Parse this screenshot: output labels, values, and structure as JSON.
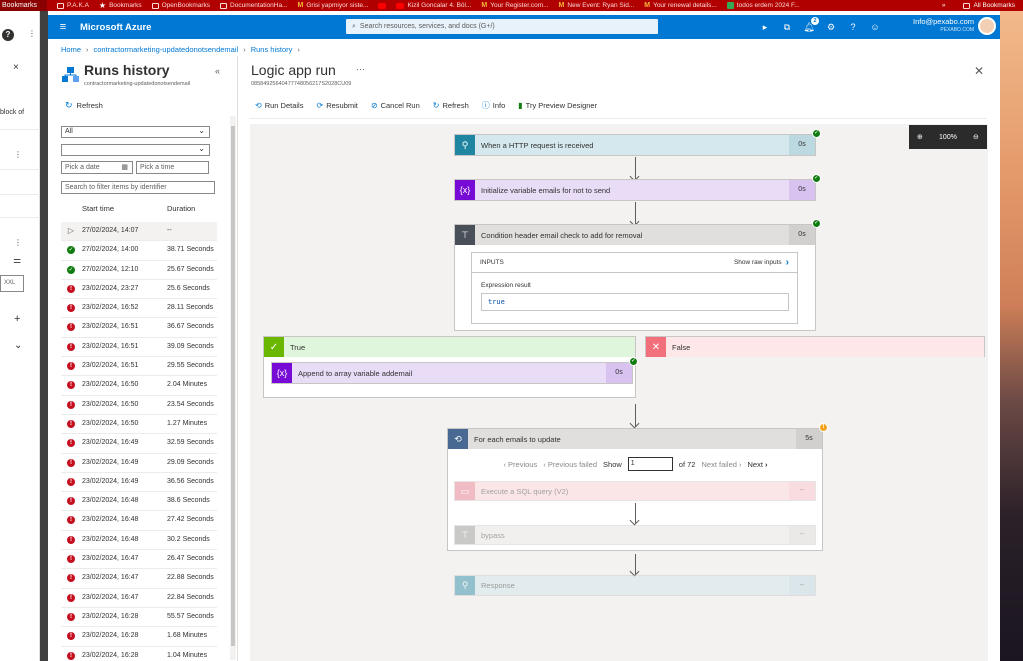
{
  "bookmarks": {
    "left_label": "Bookmarks",
    "items": [
      "P.A.K.A",
      "Bookmarks",
      "OpenBookmarks",
      "DocumentationHa...",
      "Grisi yapmiyor siste...",
      "",
      "Kizil Goncalar 4. Böl...",
      "Your Register.com...",
      "New Event: Ryan Sid...",
      "Your renewal details...",
      "todos erdem 2024 F..."
    ],
    "more": "»",
    "all": "All Bookmarks"
  },
  "left_strip": {
    "close": "×",
    "text": "block of",
    "dots1": "⋮",
    "dots2": "⋮",
    "size": "XXL",
    "plus": "+",
    "chevron": "⌄"
  },
  "header": {
    "menu": "≡",
    "title": "Microsoft Azure",
    "search_placeholder": "Search resources, services, and docs (G+/)",
    "notif_count": "2",
    "user_email": "Info@pexabo.com",
    "user_dir": "PEXABO.COM"
  },
  "breadcrumb": [
    "Home",
    "contractormarketing-updatedonotsendemail",
    "Runs history"
  ],
  "runs_history": {
    "title": "Runs history",
    "subtitle": "contractormarketing-updatedonotsendemail",
    "collapse": "«",
    "refresh": "Refresh",
    "status_filter": "All",
    "second_filter": "",
    "pick_date": "Pick a date",
    "pick_time": "Pick a time",
    "filter_placeholder": "Search to filter items by identifier",
    "col_start": "Start time",
    "col_duration": "Duration",
    "runs": [
      {
        "status": "running",
        "time": "27/02/2024, 14:07",
        "duration": "--"
      },
      {
        "status": "succeeded",
        "time": "27/02/2024, 14:00",
        "duration": "38.71 Seconds"
      },
      {
        "status": "succeeded",
        "time": "27/02/2024, 12:10",
        "duration": "25.67 Seconds"
      },
      {
        "status": "failed",
        "time": "23/02/2024, 23:27",
        "duration": "25.6 Seconds"
      },
      {
        "status": "failed",
        "time": "23/02/2024, 16:52",
        "duration": "28.11 Seconds"
      },
      {
        "status": "failed",
        "time": "23/02/2024, 16:51",
        "duration": "36.67 Seconds"
      },
      {
        "status": "failed",
        "time": "23/02/2024, 16:51",
        "duration": "39.09 Seconds"
      },
      {
        "status": "failed",
        "time": "23/02/2024, 16:51",
        "duration": "29.55 Seconds"
      },
      {
        "status": "failed",
        "time": "23/02/2024, 16:50",
        "duration": "2.04 Minutes"
      },
      {
        "status": "failed",
        "time": "23/02/2024, 16:50",
        "duration": "23.54 Seconds"
      },
      {
        "status": "failed",
        "time": "23/02/2024, 16:50",
        "duration": "1.27 Minutes"
      },
      {
        "status": "failed",
        "time": "23/02/2024, 16:49",
        "duration": "32.59 Seconds"
      },
      {
        "status": "failed",
        "time": "23/02/2024, 16:49",
        "duration": "29.09 Seconds"
      },
      {
        "status": "failed",
        "time": "23/02/2024, 16:49",
        "duration": "36.56 Seconds"
      },
      {
        "status": "failed",
        "time": "23/02/2024, 16:48",
        "duration": "38.6 Seconds"
      },
      {
        "status": "failed",
        "time": "23/02/2024, 16:48",
        "duration": "27.42 Seconds"
      },
      {
        "status": "failed",
        "time": "23/02/2024, 16:48",
        "duration": "30.2 Seconds"
      },
      {
        "status": "failed",
        "time": "23/02/2024, 16:47",
        "duration": "26.47 Seconds"
      },
      {
        "status": "failed",
        "time": "23/02/2024, 16:47",
        "duration": "22.88 Seconds"
      },
      {
        "status": "failed",
        "time": "23/02/2024, 16:47",
        "duration": "22.84 Seconds"
      },
      {
        "status": "failed",
        "time": "23/02/2024, 16:28",
        "duration": "55.57 Seconds"
      },
      {
        "status": "failed",
        "time": "23/02/2024, 16:28",
        "duration": "1.68 Minutes"
      },
      {
        "status": "failed",
        "time": "23/02/2024, 16:28",
        "duration": "1.04 Minutes"
      }
    ]
  },
  "logic_run": {
    "title": "Logic app run",
    "more": "···",
    "run_id": "08584925640477748056217S2028CU09",
    "close": "✕",
    "toolbar": [
      "Run Details",
      "Resubmit",
      "Cancel Run",
      "Refresh",
      "Info",
      "Try Preview Designer"
    ],
    "zoom": "100%",
    "steps": {
      "trigger": {
        "label": "When a HTTP request is received",
        "duration": "0s"
      },
      "init_var": {
        "label": "Initialize variable emails for not to send",
        "duration": "0s"
      },
      "condition": {
        "label": "Condition header email check to add for removal",
        "duration": "0s",
        "inputs_label": "INPUTS",
        "show_raw": "Show raw inputs",
        "expr_label": "Expression result",
        "expr_value": "true"
      },
      "true_branch": {
        "label": "True",
        "action": "Append to array variable addemail",
        "duration": "0s"
      },
      "false_branch": {
        "label": "False"
      },
      "foreach": {
        "label": "For each emails to update",
        "duration": "5s",
        "previous": "Previous",
        "previous_failed": "Previous failed",
        "show": "Show",
        "page": "1",
        "of": "of 72",
        "next_failed": "Next failed",
        "next": "Next"
      },
      "sql": {
        "label": "Execute a SQL query (V2)",
        "duration": "--"
      },
      "bypass": {
        "label": "bypass",
        "duration": "--"
      },
      "response": {
        "label": "Response",
        "duration": "--"
      }
    }
  },
  "colors": {
    "azure_blue": "#0078d4",
    "trigger_teal": "#1f85a0",
    "variable_purple": "#770bd6",
    "condition_gray": "#484f58",
    "success": "#107c10",
    "failed": "#c50f1f"
  }
}
